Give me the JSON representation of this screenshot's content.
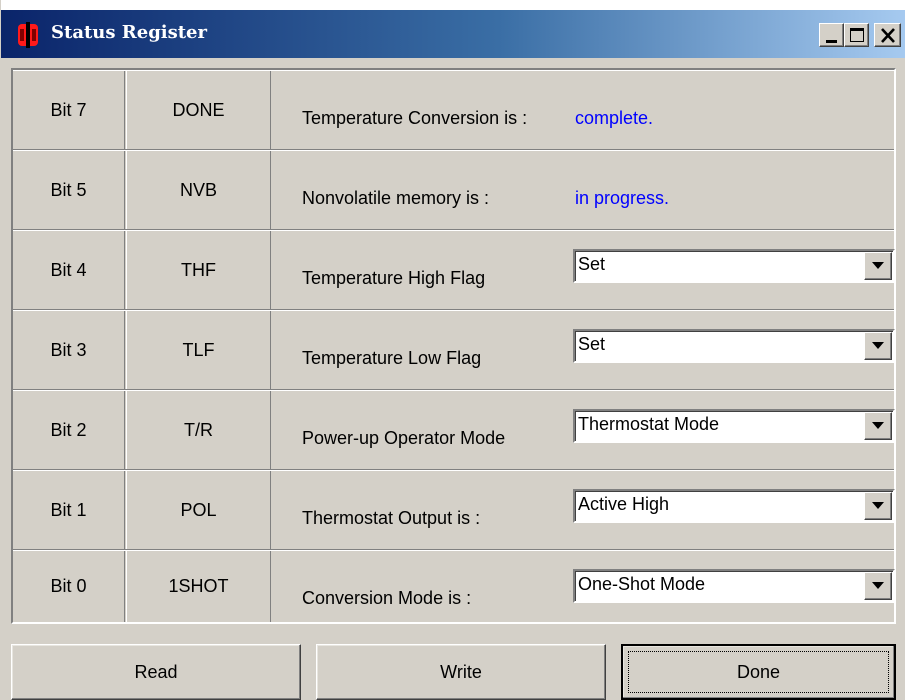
{
  "window": {
    "title": "Status Register"
  },
  "rows": [
    {
      "bit": "Bit 7",
      "name": "DONE",
      "desc": "Temperature Conversion is :",
      "value": "complete."
    },
    {
      "bit": "Bit 5",
      "name": "NVB",
      "desc": "Nonvolatile memory is :",
      "value": "in progress."
    },
    {
      "bit": "Bit 4",
      "name": "THF",
      "desc": "Temperature High Flag",
      "select": "Set"
    },
    {
      "bit": "Bit 3",
      "name": "TLF",
      "desc": "Temperature Low Flag",
      "select": "Set"
    },
    {
      "bit": "Bit 2",
      "name": "T/R",
      "desc": "Power-up Operator Mode",
      "select": "Thermostat Mode"
    },
    {
      "bit": "Bit 1",
      "name": "POL",
      "desc": "Thermostat Output is :",
      "select": "Active High"
    },
    {
      "bit": "Bit 0",
      "name": "1SHOT",
      "desc": "Conversion Mode is :",
      "select": "One-Shot Mode"
    }
  ],
  "buttons": {
    "read": "Read",
    "write": "Write",
    "done": "Done"
  },
  "colors": {
    "status_value": "#0000ff",
    "titlebar_start": "#0a246a",
    "titlebar_end": "#a6caf0",
    "face": "#d4d0c8"
  },
  "icons": {
    "app": "red-chip-icon",
    "minimize": "minimize-icon",
    "maximize": "maximize-icon",
    "close": "close-icon",
    "dropdown": "chevron-down-icon"
  }
}
